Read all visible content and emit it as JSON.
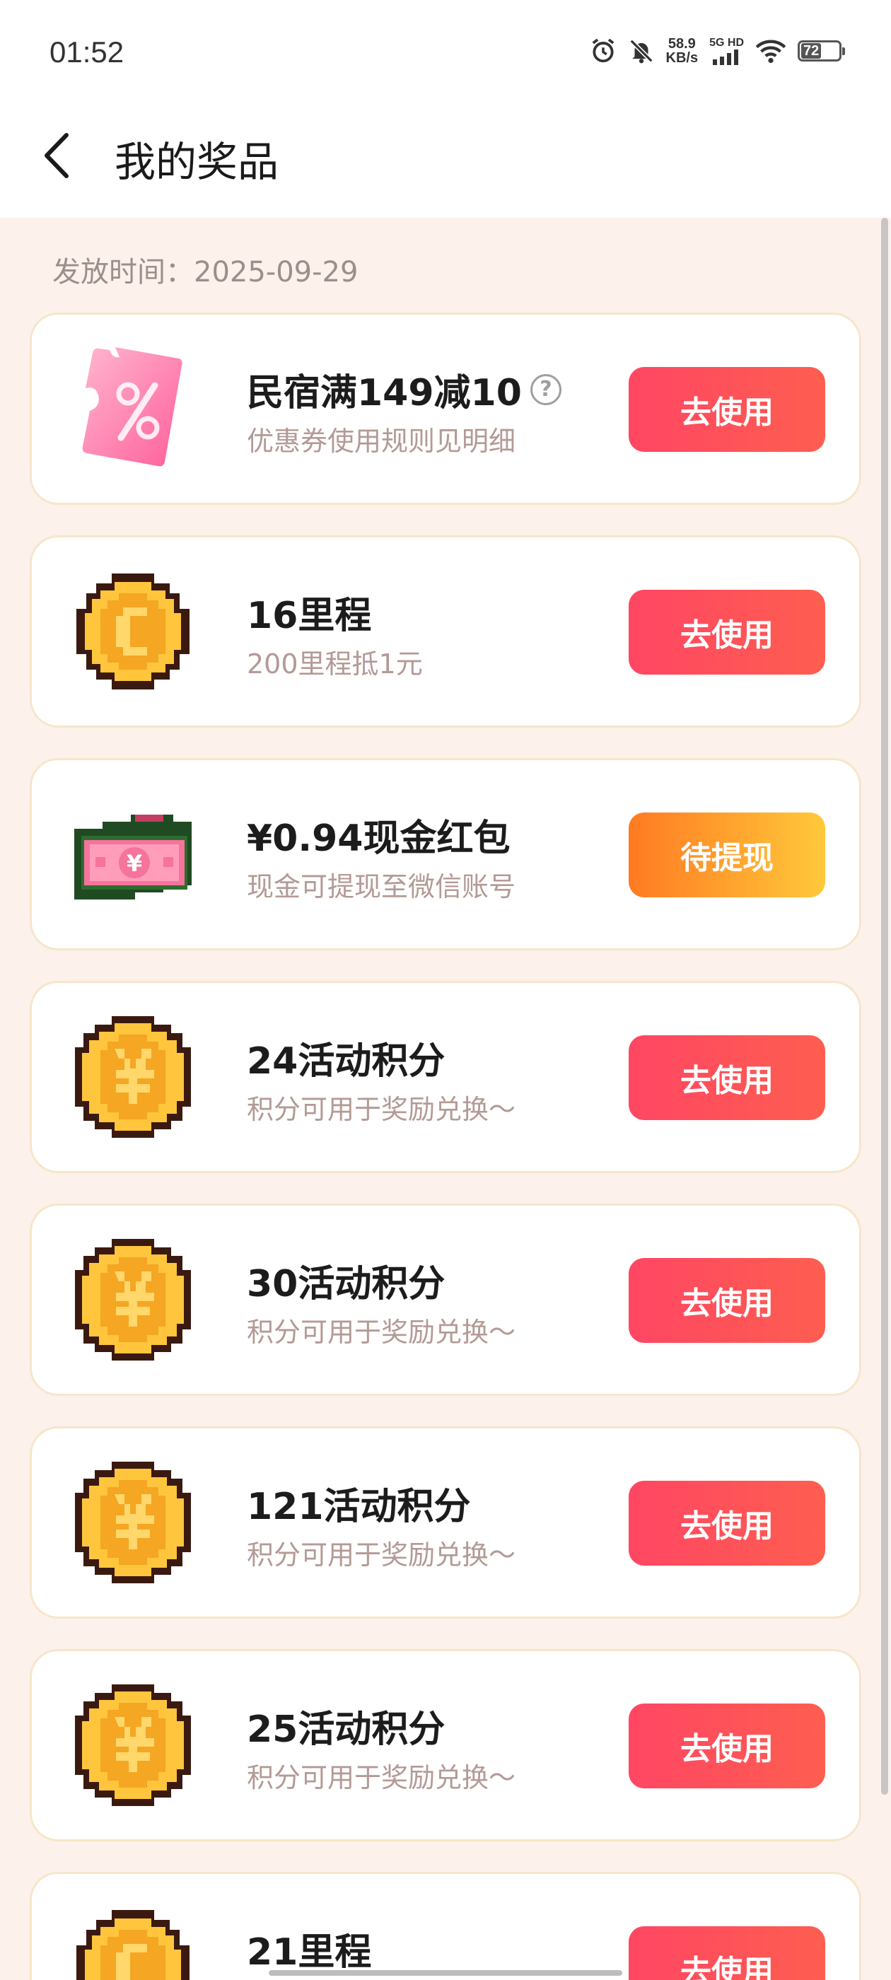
{
  "status_bar": {
    "time": "01:52",
    "net_speed_value": "58.9",
    "net_speed_unit": "KB/s",
    "signal_label": "5G HD",
    "battery": "72"
  },
  "header": {
    "title": "我的奖品"
  },
  "issue_date": "发放时间：2025-09-29",
  "prizes": [
    {
      "title": "民宿满149减10",
      "subtitle": "优惠券使用规则见明细",
      "button": "去使用",
      "icon": "coupon-icon",
      "has_help": true
    },
    {
      "title": "16里程",
      "subtitle": "200里程抵1元",
      "button": "去使用",
      "icon": "mileage-coin-icon"
    },
    {
      "title": "¥0.94现金红包",
      "subtitle": "现金可提现至微信账号",
      "button": "待提现",
      "icon": "cash-money-icon"
    },
    {
      "title": "24活动积分",
      "subtitle": "积分可用于奖励兑换～",
      "button": "去使用",
      "icon": "yuan-coin-icon"
    },
    {
      "title": "30活动积分",
      "subtitle": "积分可用于奖励兑换～",
      "button": "去使用",
      "icon": "yuan-coin-icon"
    },
    {
      "title": "121活动积分",
      "subtitle": "积分可用于奖励兑换～",
      "button": "去使用",
      "icon": "yuan-coin-icon"
    },
    {
      "title": "25活动积分",
      "subtitle": "积分可用于奖励兑换～",
      "button": "去使用",
      "icon": "yuan-coin-icon"
    },
    {
      "title": "21里程",
      "subtitle": "",
      "button": "去使用",
      "icon": "mileage-coin-icon"
    }
  ],
  "colors": {
    "primary_button": "#ff4663",
    "pending_button": "#ff7a22",
    "page_background": "#fdf1ec",
    "card_border": "#f6e6c9"
  }
}
